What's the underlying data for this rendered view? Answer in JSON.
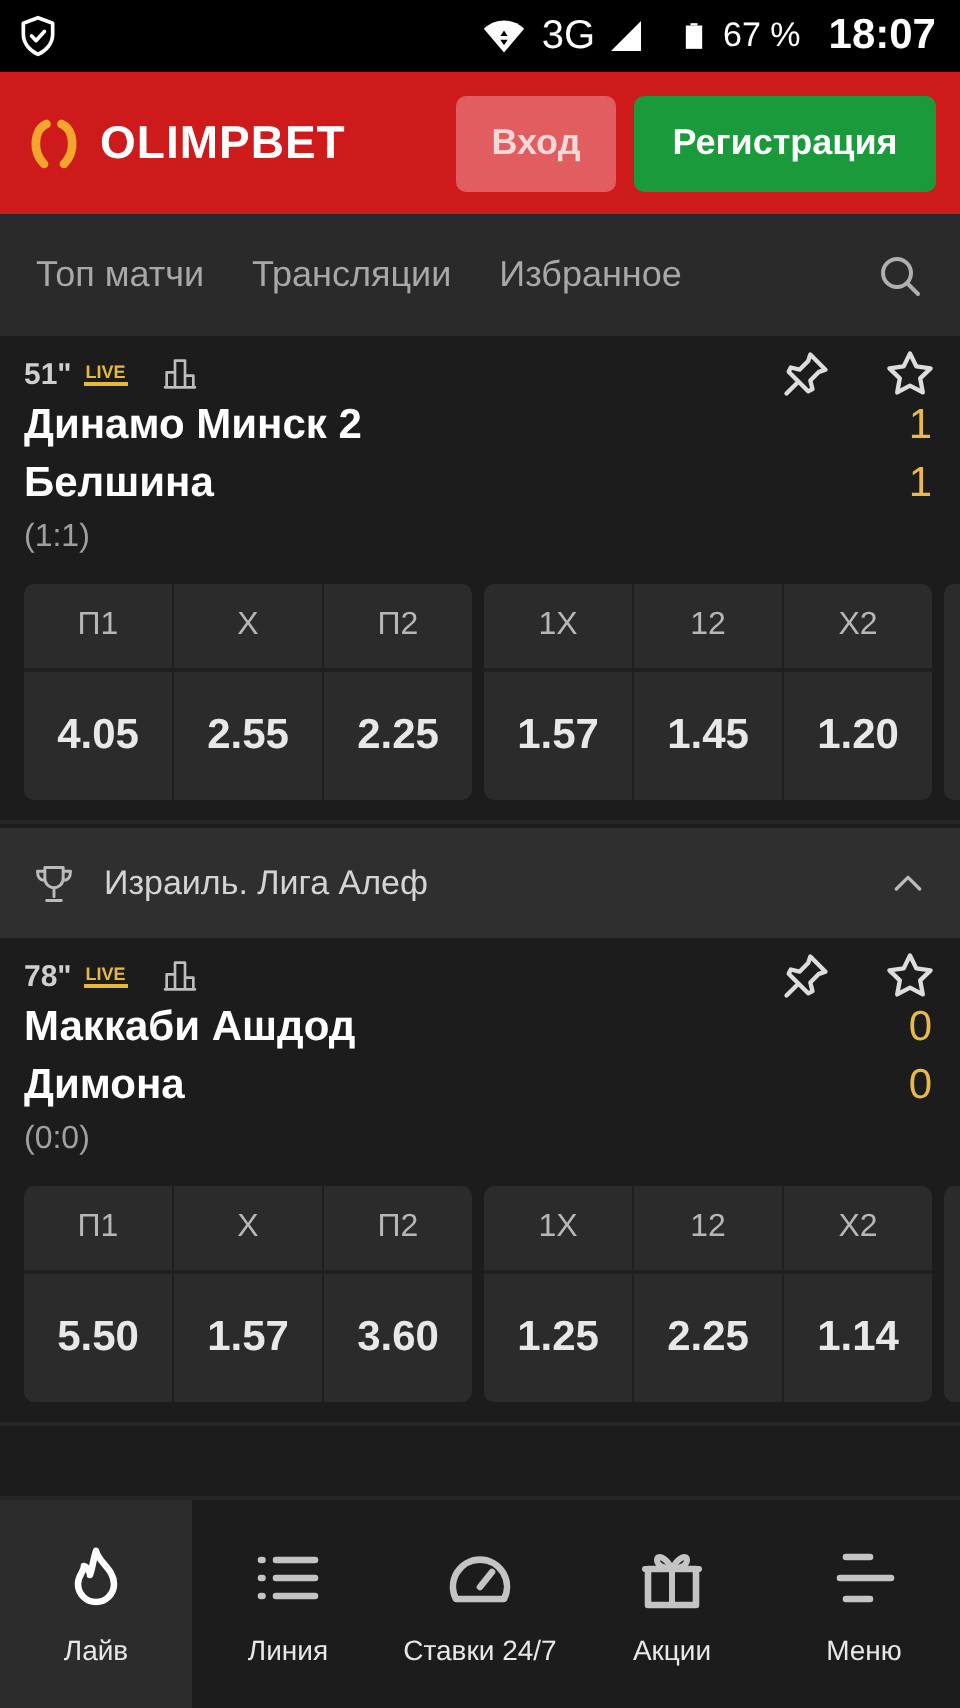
{
  "status_bar": {
    "network": "3G",
    "battery": "67 %",
    "time": "18:07"
  },
  "header": {
    "logo": "OLIMPBET",
    "buttons": [
      {
        "label": "Вход",
        "kind": "login"
      },
      {
        "label": "Регистрация",
        "kind": "register"
      }
    ]
  },
  "tabs": [
    {
      "label": "Топ матчи",
      "selected": false
    },
    {
      "label": "Трансляции",
      "selected": false
    },
    {
      "label": "Избранное",
      "selected": false
    }
  ],
  "sections": [
    {
      "kind": "match",
      "minute": "51\"",
      "live": "LIVE",
      "teams": [
        {
          "name": "Динамо Минск 2",
          "score": "1"
        },
        {
          "name": "Белшина",
          "score": "1"
        }
      ],
      "halftime": "(1:1)",
      "odds": [
        [
          {
            "label": "П1",
            "value": "4.05"
          },
          {
            "label": "X",
            "value": "2.55"
          },
          {
            "label": "П2",
            "value": "2.25"
          }
        ],
        [
          {
            "label": "1X",
            "value": "1.57"
          },
          {
            "label": "12",
            "value": "1.45"
          },
          {
            "label": "X2",
            "value": "1.20"
          }
        ]
      ]
    },
    {
      "kind": "league",
      "title": "Израиль. Лига Алеф",
      "expanded": true
    },
    {
      "kind": "match",
      "minute": "78\"",
      "live": "LIVE",
      "teams": [
        {
          "name": "Маккаби Ашдод",
          "score": "0"
        },
        {
          "name": "Димона",
          "score": "0"
        }
      ],
      "halftime": "(0:0)",
      "odds": [
        [
          {
            "label": "П1",
            "value": "5.50"
          },
          {
            "label": "X",
            "value": "1.57"
          },
          {
            "label": "П2",
            "value": "3.60"
          }
        ],
        [
          {
            "label": "1X",
            "value": "1.25"
          },
          {
            "label": "12",
            "value": "2.25"
          },
          {
            "label": "X2",
            "value": "1.14"
          }
        ]
      ]
    }
  ],
  "bottom_nav": [
    {
      "label": "Лайв",
      "selected": true
    },
    {
      "label": "Линия",
      "selected": false
    },
    {
      "label": "Ставки 24/7",
      "selected": false
    },
    {
      "label": "Акции",
      "selected": false
    },
    {
      "label": "Меню",
      "selected": false
    }
  ]
}
